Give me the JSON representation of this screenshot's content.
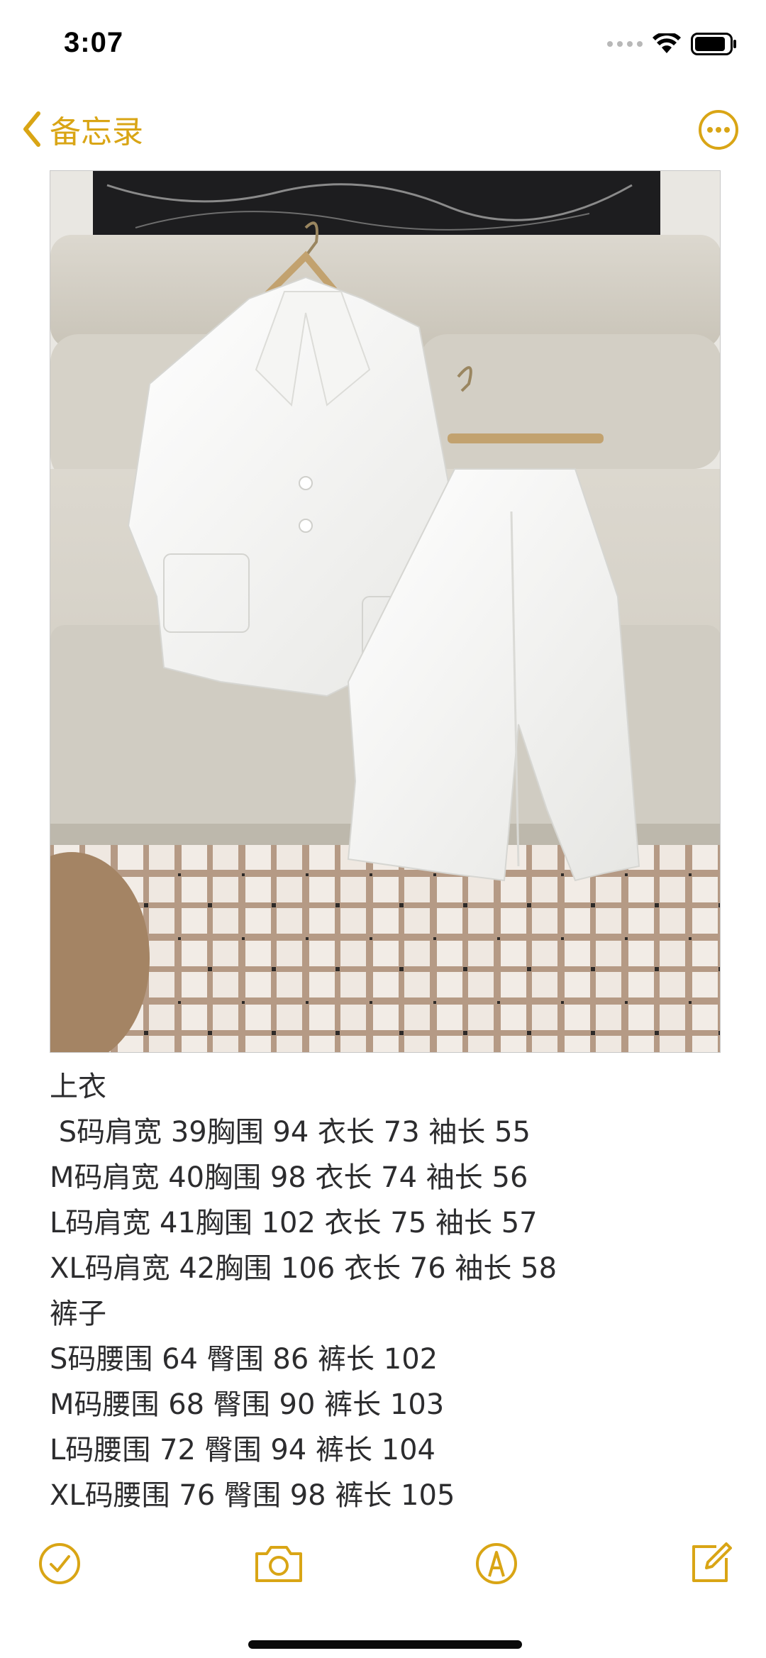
{
  "status_bar": {
    "time": "3:07"
  },
  "nav": {
    "back_label": "备忘录",
    "back_icon": "chevron-left-icon",
    "more_icon": "ellipsis-circle-icon",
    "accent_color": "#d9a515"
  },
  "note": {
    "lines": [
      "上衣",
      " S码肩宽 39胸围 94 衣长 73 袖长 55",
      "M码肩宽 40胸围 98 衣长 74 袖长 56",
      "L码肩宽 41胸围 102 衣长 75 袖长 57",
      "XL码肩宽 42胸围 106 衣长 76 袖长 58",
      "裤子",
      "S码腰围 64 臀围 86 裤长 102",
      "M码腰围 68 臀围 90 裤长 103",
      "L码腰围 72 臀围 94 裤长 104",
      "XL码腰围 76 臀围 98 裤长 105"
    ]
  },
  "toolbar": {
    "checklist_icon": "checklist-icon",
    "camera_icon": "camera-icon",
    "markup_icon": "markup-pen-icon",
    "compose_icon": "compose-icon"
  }
}
